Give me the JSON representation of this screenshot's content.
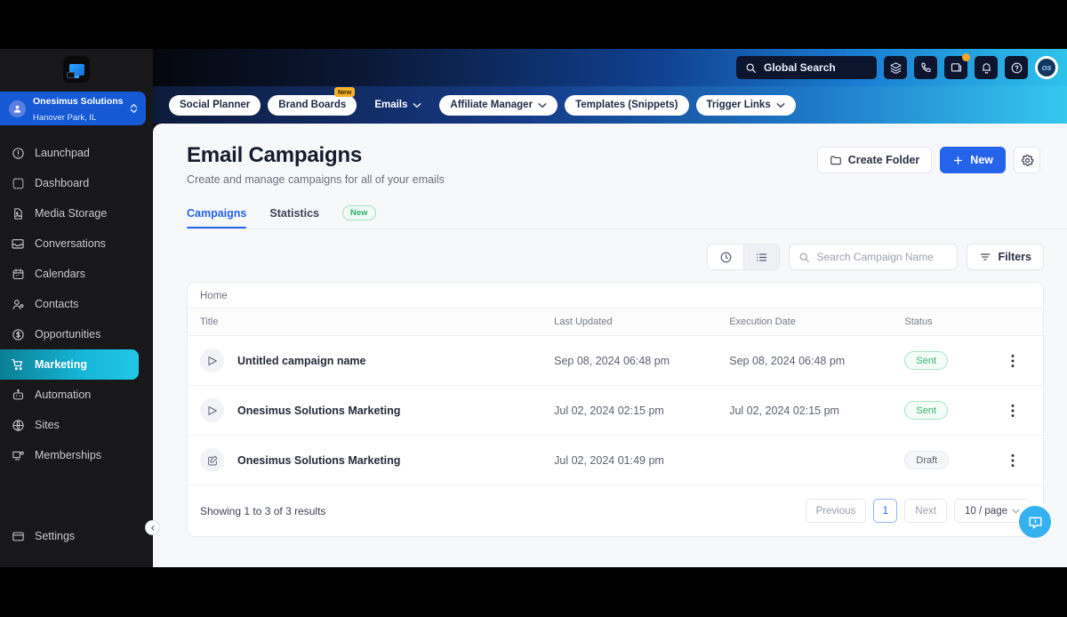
{
  "brand": {
    "logo_name": "app-logo",
    "accent": "#2563eb",
    "marketing_accent": "#16b6d8"
  },
  "topbar": {
    "search_placeholder": "Global Search",
    "icons": [
      {
        "name": "layers-icon",
        "badge": false
      },
      {
        "name": "phone-icon",
        "badge": false
      },
      {
        "name": "whats-new-icon",
        "badge": true
      },
      {
        "name": "bell-icon",
        "badge": false
      },
      {
        "name": "help-circle-icon",
        "badge": false
      }
    ],
    "avatar_initials": "OS"
  },
  "nav_tabs": [
    {
      "label": "Social Planner",
      "style": "solid",
      "caret": false,
      "tag": ""
    },
    {
      "label": "Brand Boards",
      "style": "solid",
      "caret": false,
      "tag": "New"
    },
    {
      "label": "Emails",
      "style": "ghost",
      "caret": true,
      "tag": ""
    },
    {
      "label": "Affiliate Manager",
      "style": "solid",
      "caret": true,
      "tag": ""
    },
    {
      "label": "Templates (Snippets)",
      "style": "solid",
      "caret": false,
      "tag": ""
    },
    {
      "label": "Trigger Links",
      "style": "solid",
      "caret": true,
      "tag": ""
    }
  ],
  "sidebar": {
    "org": {
      "name": "Onesimus Solutions",
      "location": "Hanover Park, IL"
    },
    "items": [
      {
        "label": "Launchpad",
        "icon": "rocket-circle-icon",
        "active": false
      },
      {
        "label": "Dashboard",
        "icon": "dashboard-icon",
        "active": false
      },
      {
        "label": "Media Storage",
        "icon": "image-file-icon",
        "active": false
      },
      {
        "label": "Conversations",
        "icon": "inbox-icon",
        "active": false
      },
      {
        "label": "Calendars",
        "icon": "calendar-icon",
        "active": false
      },
      {
        "label": "Contacts",
        "icon": "user-icon",
        "active": false
      },
      {
        "label": "Opportunities",
        "icon": "dollar-circle-icon",
        "active": false
      },
      {
        "label": "Marketing",
        "icon": "cart-icon",
        "active": true
      },
      {
        "label": "Automation",
        "icon": "robot-icon",
        "active": false
      },
      {
        "label": "Sites",
        "icon": "globe-icon",
        "active": false
      },
      {
        "label": "Memberships",
        "icon": "monitor-icon",
        "active": false
      }
    ],
    "settings": {
      "label": "Settings",
      "icon": "window-icon"
    },
    "collapse": "chevron-left-icon"
  },
  "page": {
    "title": "Email Campaigns",
    "subtitle": "Create and manage campaigns for all of your emails",
    "create_folder_label": "Create Folder",
    "new_label": "New",
    "settings_icon": "gear-icon"
  },
  "tabs": [
    {
      "label": "Campaigns",
      "active": true
    },
    {
      "label": "Statistics",
      "active": false
    }
  ],
  "tabs_badge": "New",
  "toolbar": {
    "recent_view_icon": "clock-icon",
    "list_view_icon": "list-icon",
    "search_placeholder": "Search Campaign Name",
    "filters_label": "Filters"
  },
  "table": {
    "breadcrumb": "Home",
    "columns": [
      "Title",
      "Last Updated",
      "Execution Date",
      "Status",
      ""
    ],
    "rows": [
      {
        "icon": "send-icon",
        "title": "Untitled campaign name",
        "last_updated": "Sep 08, 2024 06:48 pm",
        "execution_date": "Sep 08, 2024 06:48 pm",
        "status": "Sent",
        "status_kind": "sent",
        "menu": "kebab-menu-icon"
      },
      {
        "icon": "send-icon",
        "title": "Onesimus Solutions Marketing",
        "last_updated": "Jul 02, 2024 02:15 pm",
        "execution_date": "Jul 02, 2024 02:15 pm",
        "status": "Sent",
        "status_kind": "sent",
        "menu": "kebab-menu-icon"
      },
      {
        "icon": "edit-square-icon",
        "title": "Onesimus Solutions Marketing",
        "last_updated": "Jul 02, 2024 01:49 pm",
        "execution_date": "",
        "status": "Draft",
        "status_kind": "draft",
        "menu": "kebab-menu-icon"
      }
    ]
  },
  "pagination": {
    "summary": "Showing 1 to 3 of 3 results",
    "previous": "Previous",
    "page": "1",
    "next": "Next",
    "per_page": "10 / page"
  },
  "chat_widget": {
    "icon": "chat-info-icon"
  }
}
